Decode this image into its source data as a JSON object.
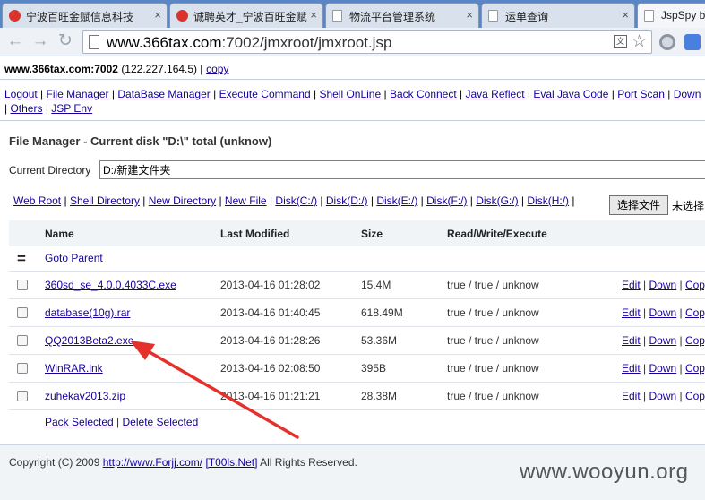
{
  "browser": {
    "tabs": [
      {
        "title": "宁波百旺金赋信息科技",
        "icon": "red-circle-icon"
      },
      {
        "title": "诚聘英才_宁波百旺金赋",
        "icon": "red-circle-icon"
      },
      {
        "title": "物流平台管理系统",
        "icon": "page-icon"
      },
      {
        "title": "运单查询",
        "icon": "page-icon"
      },
      {
        "title": "JspSpy b",
        "icon": "page-icon"
      }
    ],
    "url_host": "www.366tax.com",
    "url_rest": ":7002/jmxroot/jmxroot.jsp"
  },
  "host": {
    "name": "www.366tax.com:7002",
    "ip": "(122.227.164.5)",
    "sep": "|",
    "copy": "copy"
  },
  "menu": [
    "Logout",
    "File Manager",
    "DataBase Manager",
    "Execute Command",
    "Shell OnLine",
    "Back Connect",
    "Java Reflect",
    "Eval Java Code",
    "Port Scan",
    "Down",
    "Others",
    "JSP Env"
  ],
  "file_manager": {
    "title": "File Manager - Current disk \"D:\\\" total (unknow)",
    "current_dir_label": "Current Directory",
    "current_dir_value": "D:/新建文件夹",
    "shortcuts": [
      "Web Root",
      "Shell Directory",
      "New Directory",
      "New File",
      "Disk(C:/)",
      "Disk(D:/)",
      "Disk(E:/)",
      "Disk(F:/)",
      "Disk(G:/)",
      "Disk(H:/)"
    ],
    "choose_file_button": "选择文件",
    "choose_file_text": "未选择"
  },
  "table": {
    "headers": {
      "name": "Name",
      "modified": "Last Modified",
      "size": "Size",
      "rwx": "Read/Write/Execute"
    },
    "parent_symbol": "=",
    "parent_link": "Goto Parent",
    "rows": [
      {
        "name": "360sd_se_4.0.0.4033C.exe",
        "modified": "2013-04-16 01:28:02",
        "size": "15.4M",
        "rwx": "true / true / unknow"
      },
      {
        "name": "database(10g).rar",
        "modified": "2013-04-16 01:40:45",
        "size": "618.49M",
        "rwx": "true / true / unknow"
      },
      {
        "name": "QQ2013Beta2.exe",
        "modified": "2013-04-16 01:28:26",
        "size": "53.36M",
        "rwx": "true / true / unknow"
      },
      {
        "name": "WinRAR.lnk",
        "modified": "2013-04-16 02:08:50",
        "size": "395B",
        "rwx": "true / true / unknow"
      },
      {
        "name": "zuhekav2013.zip",
        "modified": "2013-04-16 01:21:21",
        "size": "28.38M",
        "rwx": "true / true / unknow"
      }
    ],
    "actions": {
      "edit": "Edit",
      "down": "Down",
      "copy": "Copy"
    },
    "pack_selected": "Pack Selected",
    "delete_selected": "Delete Selected"
  },
  "footer": {
    "prefix": "Copyright (C) 2009",
    "link1": "http://www.Forjj.com/",
    "link2": "[T00ls.Net]",
    "suffix": "All Rights Reserved."
  },
  "watermark": "www.wooyun.org",
  "colors": {
    "link": "#15009a",
    "arrow": "#e5312b",
    "tabbar": "#5a86c6"
  }
}
